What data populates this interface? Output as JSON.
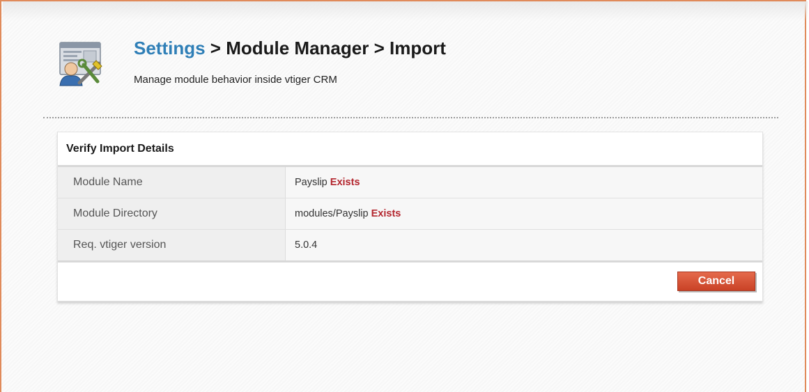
{
  "header": {
    "breadcrumb_link": "Settings",
    "breadcrumb_rest": " > Module Manager > Import",
    "subtitle": "Manage module behavior inside vtiger CRM",
    "icon": "settings-tools-icon"
  },
  "panel": {
    "title": "Verify Import Details",
    "rows": [
      {
        "label": "Module Name",
        "value": "Payslip",
        "status": "Exists"
      },
      {
        "label": "Module Directory",
        "value": "modules/Payslip",
        "status": "Exists"
      },
      {
        "label": "Req. vtiger version",
        "value": "5.0.4"
      }
    ],
    "cancel_label": "Cancel"
  },
  "colors": {
    "link": "#2f7fb7",
    "exists": "#b3262e",
    "cancel_button": "#d9553a",
    "frame_border": "#e08a5a"
  }
}
